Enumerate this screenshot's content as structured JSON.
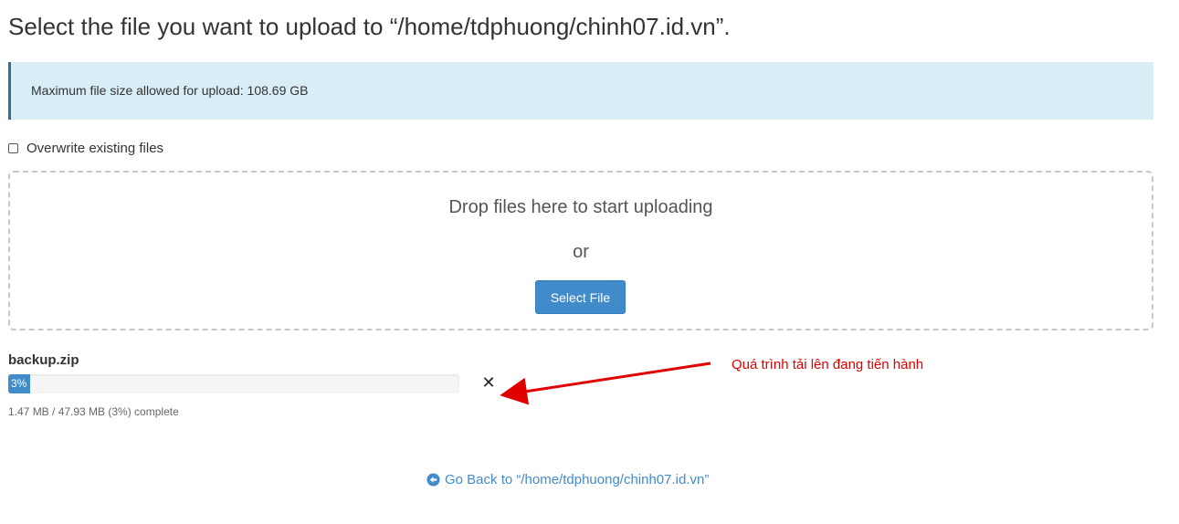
{
  "page": {
    "title": "Select the file you want to upload to “/home/tdphuong/chinh07.id.vn”."
  },
  "info": {
    "max_size": "Maximum file size allowed for upload: 108.69 GB"
  },
  "options": {
    "overwrite_label": "Overwrite existing files",
    "overwrite_checked": false
  },
  "dropzone": {
    "drop_text": "Drop files here to start uploading",
    "or_text": "or",
    "select_button": "Select File"
  },
  "upload": {
    "file_name": "backup.zip",
    "progress_percent": 3,
    "progress_label": "3%",
    "status": "1.47 MB / 47.93 MB (3%) complete",
    "cancel_icon": "close-icon"
  },
  "annotation": {
    "text": "Quá trình tải lên đang tiến hành",
    "color": "#e00000"
  },
  "footer": {
    "back_link": "Go Back to “/home/tdphuong/chinh07.id.vn”",
    "back_icon": "arrow-left-circle-icon"
  },
  "colors": {
    "accent": "#428bca",
    "info_bg": "#d9edf7",
    "info_border": "#31708f"
  }
}
